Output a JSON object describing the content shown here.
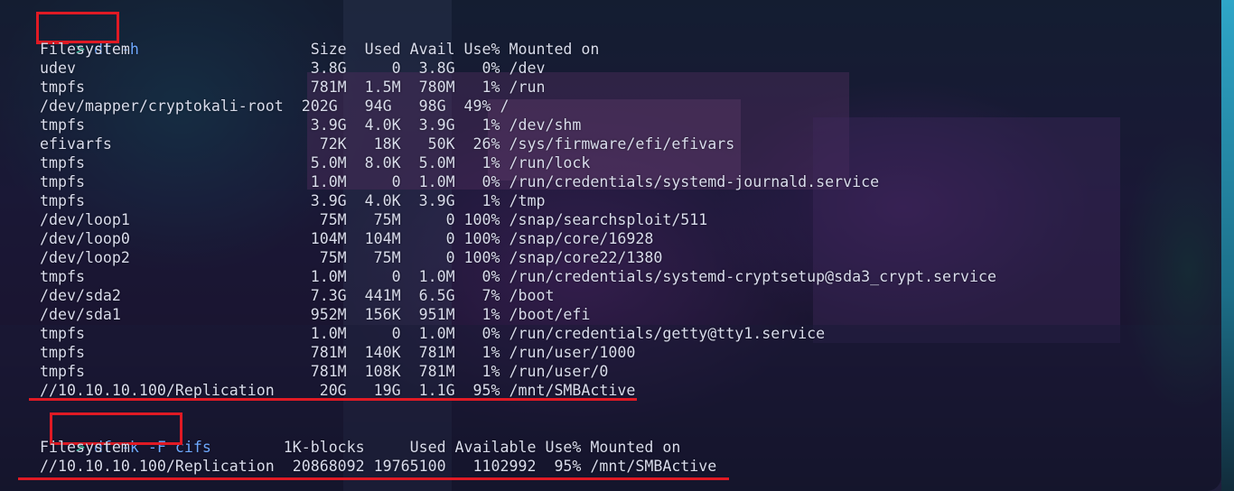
{
  "terminal": {
    "command1": {
      "prompt": ">",
      "text": "df -h"
    },
    "output1": {
      "header": "Filesystem                    Size  Used Avail Use% Mounted on",
      "rows": [
        "udev                          3.8G     0  3.8G   0% /dev",
        "tmpfs                         781M  1.5M  780M   1% /run",
        "/dev/mapper/cryptokali-root  202G   94G   98G  49% /",
        "tmpfs                         3.9G  4.0K  3.9G   1% /dev/shm",
        "efivarfs                       72K   18K   50K  26% /sys/firmware/efi/efivars",
        "tmpfs                         5.0M  8.0K  5.0M   1% /run/lock",
        "tmpfs                         1.0M     0  1.0M   0% /run/credentials/systemd-journald.service",
        "tmpfs                         3.9G  4.0K  3.9G   1% /tmp",
        "/dev/loop1                     75M   75M     0 100% /snap/searchsploit/511",
        "/dev/loop0                    104M  104M     0 100% /snap/core/16928",
        "/dev/loop2                     75M   75M     0 100% /snap/core22/1380",
        "tmpfs                         1.0M     0  1.0M   0% /run/credentials/systemd-cryptsetup@sda3_crypt.service",
        "/dev/sda2                     7.3G  441M  6.5G   7% /boot",
        "/dev/sda1                     952M  156K  951M   1% /boot/efi",
        "tmpfs                         1.0M     0  1.0M   0% /run/credentials/getty@tty1.service",
        "tmpfs                         781M  140K  781M   1% /run/user/1000",
        "tmpfs                         781M  108K  781M   1% /run/user/0",
        "//10.10.10.100/Replication     20G   19G  1.1G  95% /mnt/SMBActive"
      ]
    },
    "command2": {
      "prompt": ">",
      "text": "df -k -F cifs"
    },
    "output2": {
      "header": "Filesystem                 1K-blocks     Used Available Use% Mounted on",
      "rows": [
        "//10.10.10.100/Replication  20868092 19765100   1102992  95% /mnt/SMBActive"
      ]
    }
  },
  "colors": {
    "text": "#d9dcec",
    "prompt_arrow": "#3fd1b0",
    "command": "#6fa8ff",
    "annotation": "#e01a24"
  }
}
